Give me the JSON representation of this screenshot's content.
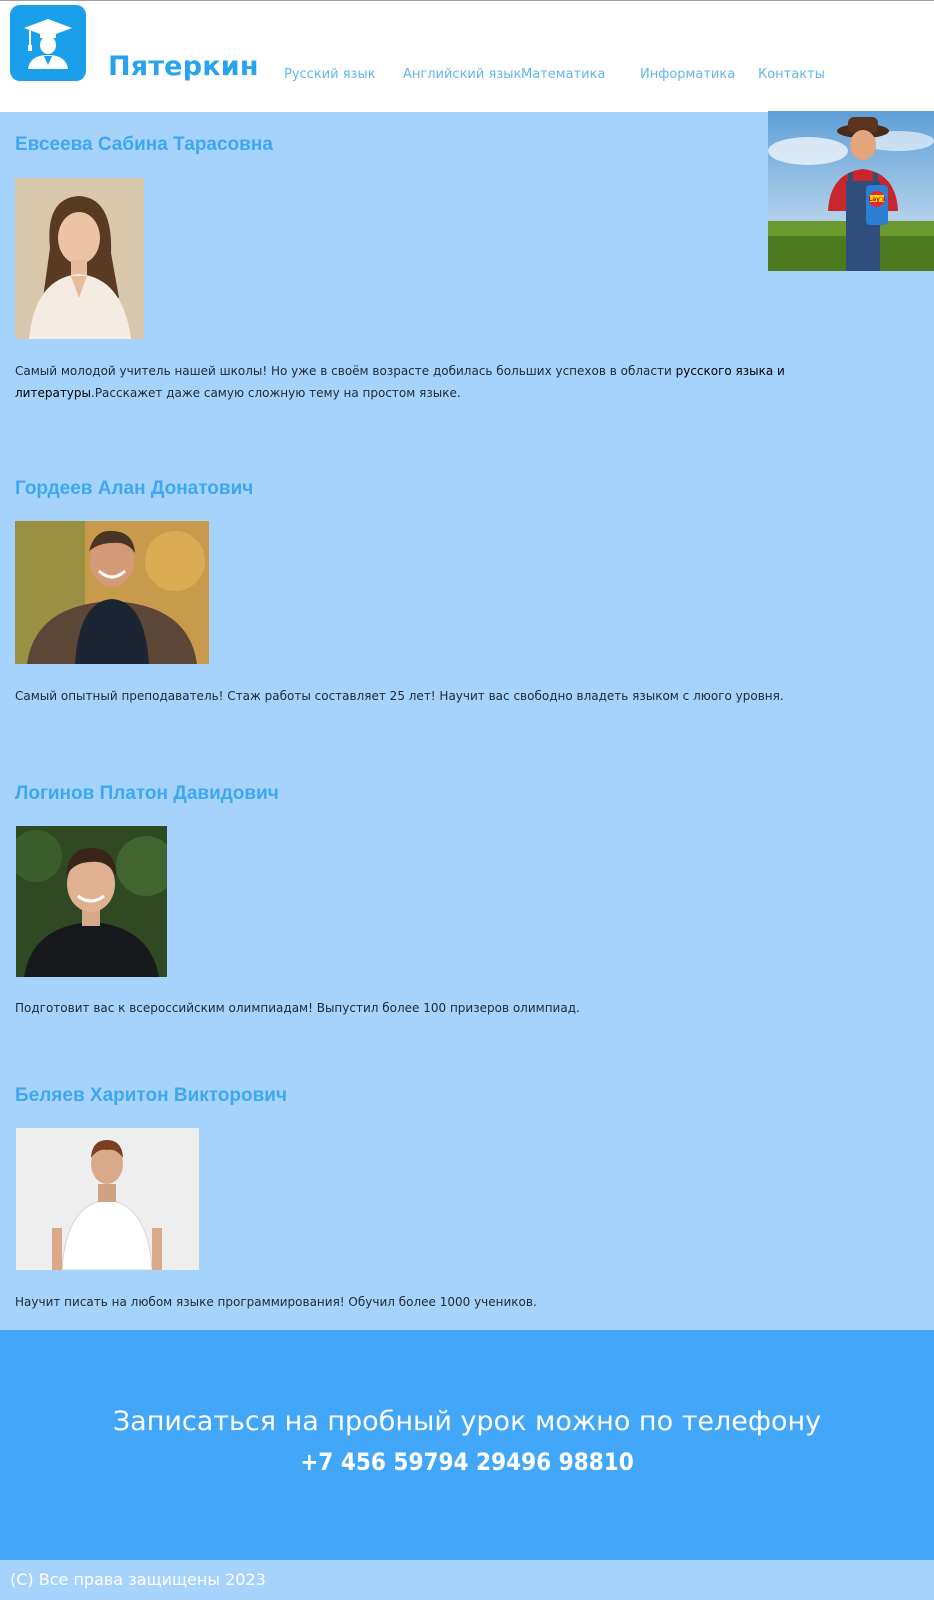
{
  "header": {
    "brand": "Пятеркин",
    "logo_icon": "graduate-icon",
    "nav": [
      {
        "label": "Русский язык"
      },
      {
        "label": "Английский язык"
      },
      {
        "label": "Математика"
      },
      {
        "label": "Информатика"
      },
      {
        "label": "Контакты"
      }
    ]
  },
  "teachers": [
    {
      "name": "Евсеева Сабина Тарасовна",
      "desc_part1": "Самый молодой учитель нашей школы! Но уже в своём возрасте добилась больших успехов в области ",
      "desc_strong": "русского языка и литературы",
      "desc_part2": ".Расскажет даже самую сложную тему на простом языке."
    },
    {
      "name": "Гордеев Алан Донатович",
      "desc": "Самый опытный преподаватель! Стаж работы составляет 25 лет! Научит вас свободно владеть языком с люого уровня."
    },
    {
      "name": "Логинов Платон Давидович",
      "desc": "Подготовит вас к всероссийским олимпиадам! Выпустил более 100 призеров олимпиад."
    },
    {
      "name": "Беляев Харитон Викторович",
      "desc": "Научит писать на любом языке программирования! Обучил более 1000 учеников."
    }
  ],
  "ad": {
    "badge": "Lay's"
  },
  "cta": {
    "line1": "Записаться на пробный урок можно по телефону",
    "phone": "+7 456 59794 29496 98810"
  },
  "footer": {
    "copyright": "(C) Все права защищены 2023"
  },
  "colors": {
    "page_bg": "#a6d3fb",
    "accent": "#27a4ea",
    "cta_bg": "#42a7f8"
  }
}
